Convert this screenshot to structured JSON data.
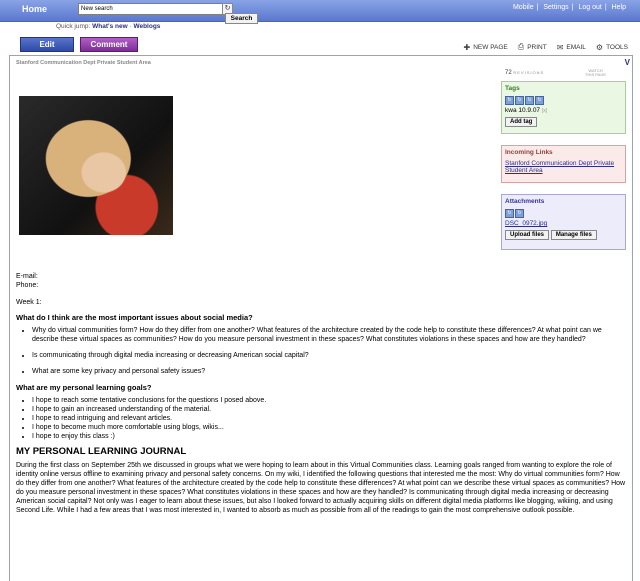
{
  "topbar": {
    "home": "Home",
    "search_value": "New search",
    "search_button": "Search",
    "links": [
      "Mobile",
      "Settings",
      "Log out",
      "Help"
    ]
  },
  "quickjump": {
    "label": "Quick jump:",
    "whats_new": "What's new",
    "weblogs": "Weblogs"
  },
  "actions": {
    "edit": "Edit",
    "comment": "Comment",
    "new_page": "NEW PAGE",
    "print": "PRINT",
    "email": "EMAIL",
    "tools": "TOOLS"
  },
  "page": {
    "breadcrumb": "Stanford Communication Dept Private Student Area",
    "revisions_count": "72",
    "revisions_label": "REVISIONS",
    "watch_label_1": "WATCH",
    "watch_label_2": "THIS PAGE"
  },
  "sidebar": {
    "tags": {
      "title": "Tags",
      "tag": "kwa 10.9.07",
      "remove": "[x]",
      "add_button": "Add tag"
    },
    "incoming": {
      "title": "Incoming Links",
      "link": "Stanford Communication Dept Private Student Area"
    },
    "attachments": {
      "title": "Attachments",
      "file": "DSC_0972.jpg",
      "upload": "Upload files",
      "manage": "Manage files"
    }
  },
  "content": {
    "email": "E-mail:",
    "phone": "Phone:",
    "week": "Week 1:",
    "h_issues": "What do I think are the most important issues about social media?",
    "issues": [
      "Why do virtual communities form? How do they differ from one another? What features of the architecture created by the code help to constitute these differences? At what point can we describe these virtual spaces as communities? How do you measure personal investment in these spaces? What constitutes violations in these spaces and how are they handled?",
      "Is communicating through digital media increasing or decreasing American social capital?",
      "What are some key privacy and personal safety issues?"
    ],
    "h_goals": "What are my personal learning goals?",
    "goals": [
      "I hope to reach some tentative conclusions for the questions I posed above.",
      "I hope to gain an increased understanding of the material.",
      "I hope to read intriguing and relevant articles.",
      "I hope to become much more comfortable using blogs, wikis...",
      "I hope to enjoy this class :)"
    ],
    "h_journal": "MY PERSONAL LEARNING JOURNAL",
    "journal": "During the first class on September 25th we discussed in groups what we were hoping to learn about in this Virtual Communities class. Learning goals ranged from wanting to explore the role of identity online versus offline to examining privacy and personal safety concerns. On my wiki, I identified the following questions that interested me the most: Why do virtual communities form? How do they differ from one another? What features of the architecture created by the code help to constitute these differences? At what point can we describe these virtual spaces as communities? How do you measure personal investment in these spaces? What constitutes violations in these spaces and how are they handled? Is communicating through digital media increasing or decreasing American social capital? Not only was I eager to learn about these issues, but also I looked forward to actually acquiring skills on different digital media platforms like blogging, wikiing, and using Second Life. While I had a few areas that I was most interested in, I wanted to absorb as much as possible from all of the readings to gain the most comprehensive outlook possible."
  }
}
